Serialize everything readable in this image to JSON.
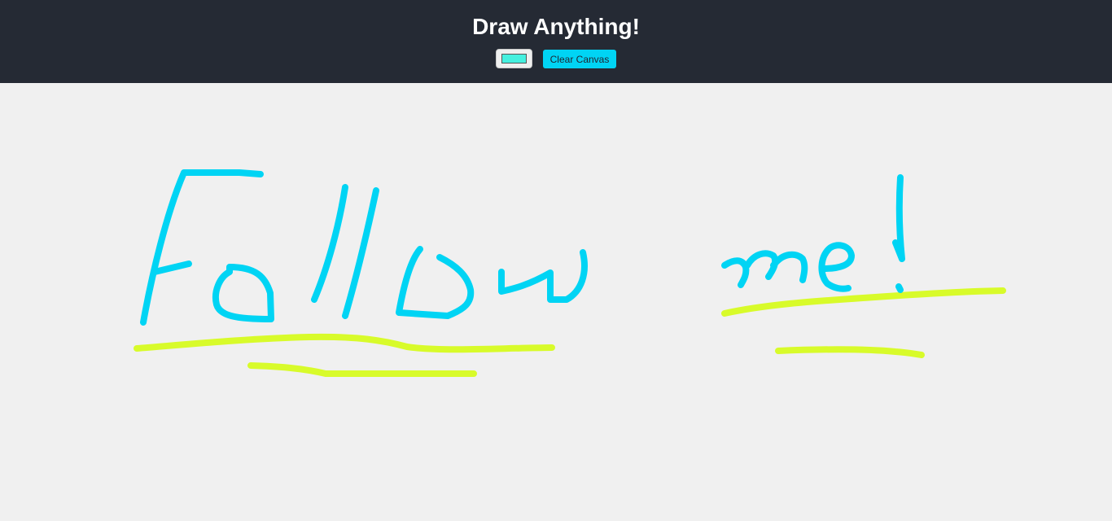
{
  "header": {
    "title": "Draw Anything!",
    "background_color": "#252a34"
  },
  "controls": {
    "color_picker_value": "#45f0df",
    "clear_button_label": "Clear Canvas",
    "clear_button_color": "#00d4f4"
  },
  "canvas": {
    "background_color": "#f0f0f0",
    "strokes": [
      {
        "color": "#00d4f4",
        "icon": "handwritten-text-follow"
      },
      {
        "color": "#00d4f4",
        "icon": "handwritten-text-me"
      },
      {
        "color": "#00d4f4",
        "icon": "exclamation-mark"
      },
      {
        "color": "#d8fb2a",
        "icon": "underline-stroke"
      }
    ]
  }
}
